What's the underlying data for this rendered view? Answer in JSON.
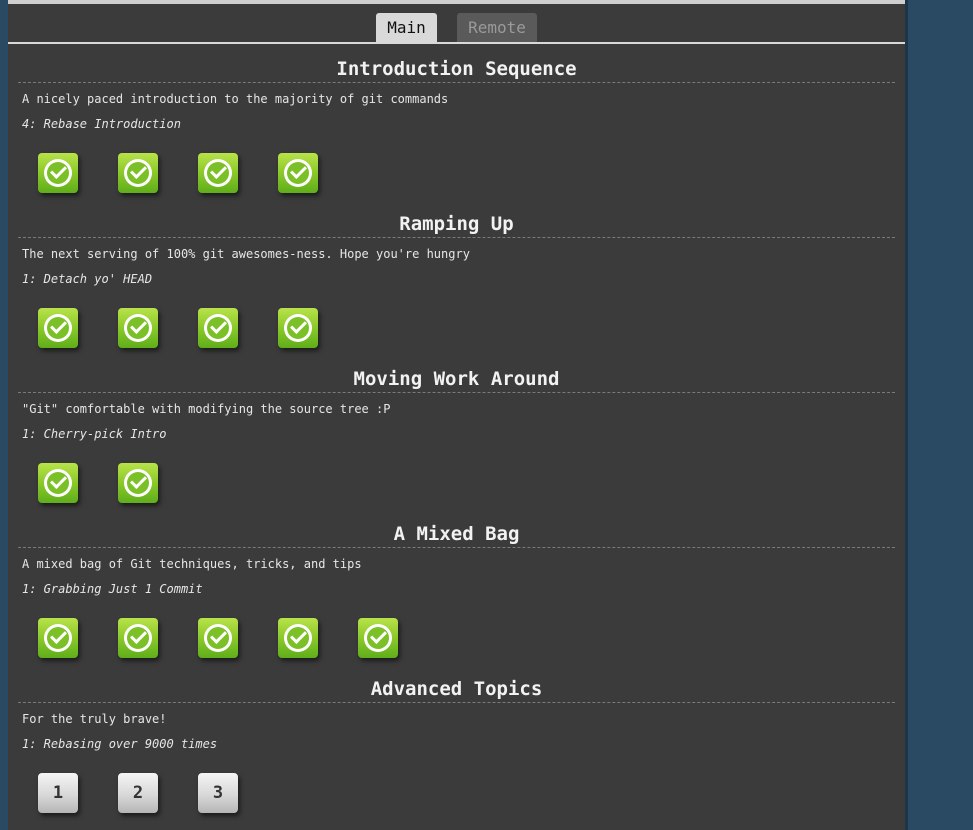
{
  "tabs": [
    {
      "label": "Main"
    },
    {
      "label": "Remote"
    }
  ],
  "sections": [
    {
      "title": "Introduction Sequence",
      "description": "A nicely paced introduction to the majority of git commands",
      "current_level": "4: Rebase Introduction",
      "levels": [
        "done",
        "done",
        "done",
        "done"
      ]
    },
    {
      "title": "Ramping Up",
      "description": "The next serving of 100% git awesomes-ness. Hope you're hungry",
      "current_level": "1: Detach yo' HEAD",
      "levels": [
        "done",
        "done",
        "done",
        "done"
      ]
    },
    {
      "title": "Moving Work Around",
      "description": "\"Git\" comfortable with modifying the source tree :P",
      "current_level": "1: Cherry-pick Intro",
      "levels": [
        "done",
        "done"
      ]
    },
    {
      "title": "A Mixed Bag",
      "description": "A mixed bag of Git techniques, tricks, and tips",
      "current_level": "1: Grabbing Just 1 Commit",
      "levels": [
        "done",
        "done",
        "done",
        "done",
        "done"
      ]
    },
    {
      "title": "Advanced Topics",
      "description": "For the truly brave!",
      "current_level": "1: Rebasing over 9000 times",
      "levels": [
        "1",
        "2",
        "3"
      ]
    }
  ]
}
